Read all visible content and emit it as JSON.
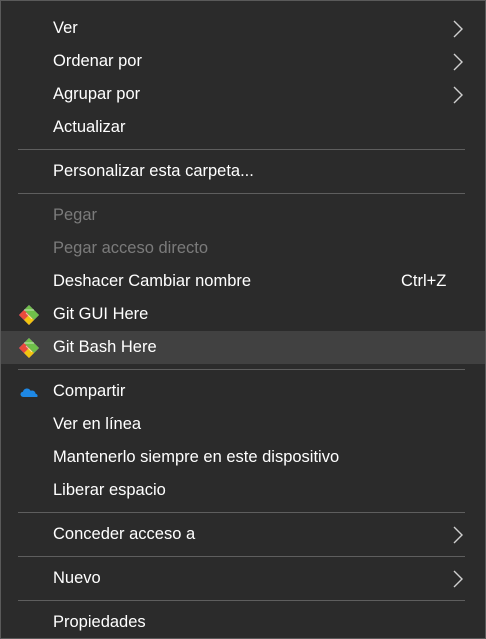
{
  "menu": {
    "items": [
      {
        "label": "Ver"
      },
      {
        "label": "Ordenar por"
      },
      {
        "label": "Agrupar por"
      },
      {
        "label": "Actualizar"
      },
      {
        "label": "Personalizar esta carpeta..."
      },
      {
        "label": "Pegar",
        "enabled": false
      },
      {
        "label": "Pegar acceso directo",
        "enabled": false
      },
      {
        "label": "Deshacer Cambiar nombre",
        "shortcut": "Ctrl+Z"
      },
      {
        "label": "Git GUI Here",
        "icon": "git-icon"
      },
      {
        "label": "Git Bash Here",
        "icon": "git-icon",
        "highlighted": true
      },
      {
        "label": "Compartir",
        "icon": "onedrive-cloud-icon"
      },
      {
        "label": "Ver en línea"
      },
      {
        "label": "Mantenerlo siempre en este dispositivo"
      },
      {
        "label": "Liberar espacio"
      },
      {
        "label": "Conceder acceso a"
      },
      {
        "label": "Nuevo"
      },
      {
        "label": "Propiedades"
      }
    ]
  },
  "colors": {
    "background": "#2b2b2b",
    "text": "#ffffff",
    "disabled_text": "#7b7b7b",
    "highlight": "#414141",
    "separator": "#5e5e5e",
    "onedrive_blue": "#1e88e5"
  }
}
